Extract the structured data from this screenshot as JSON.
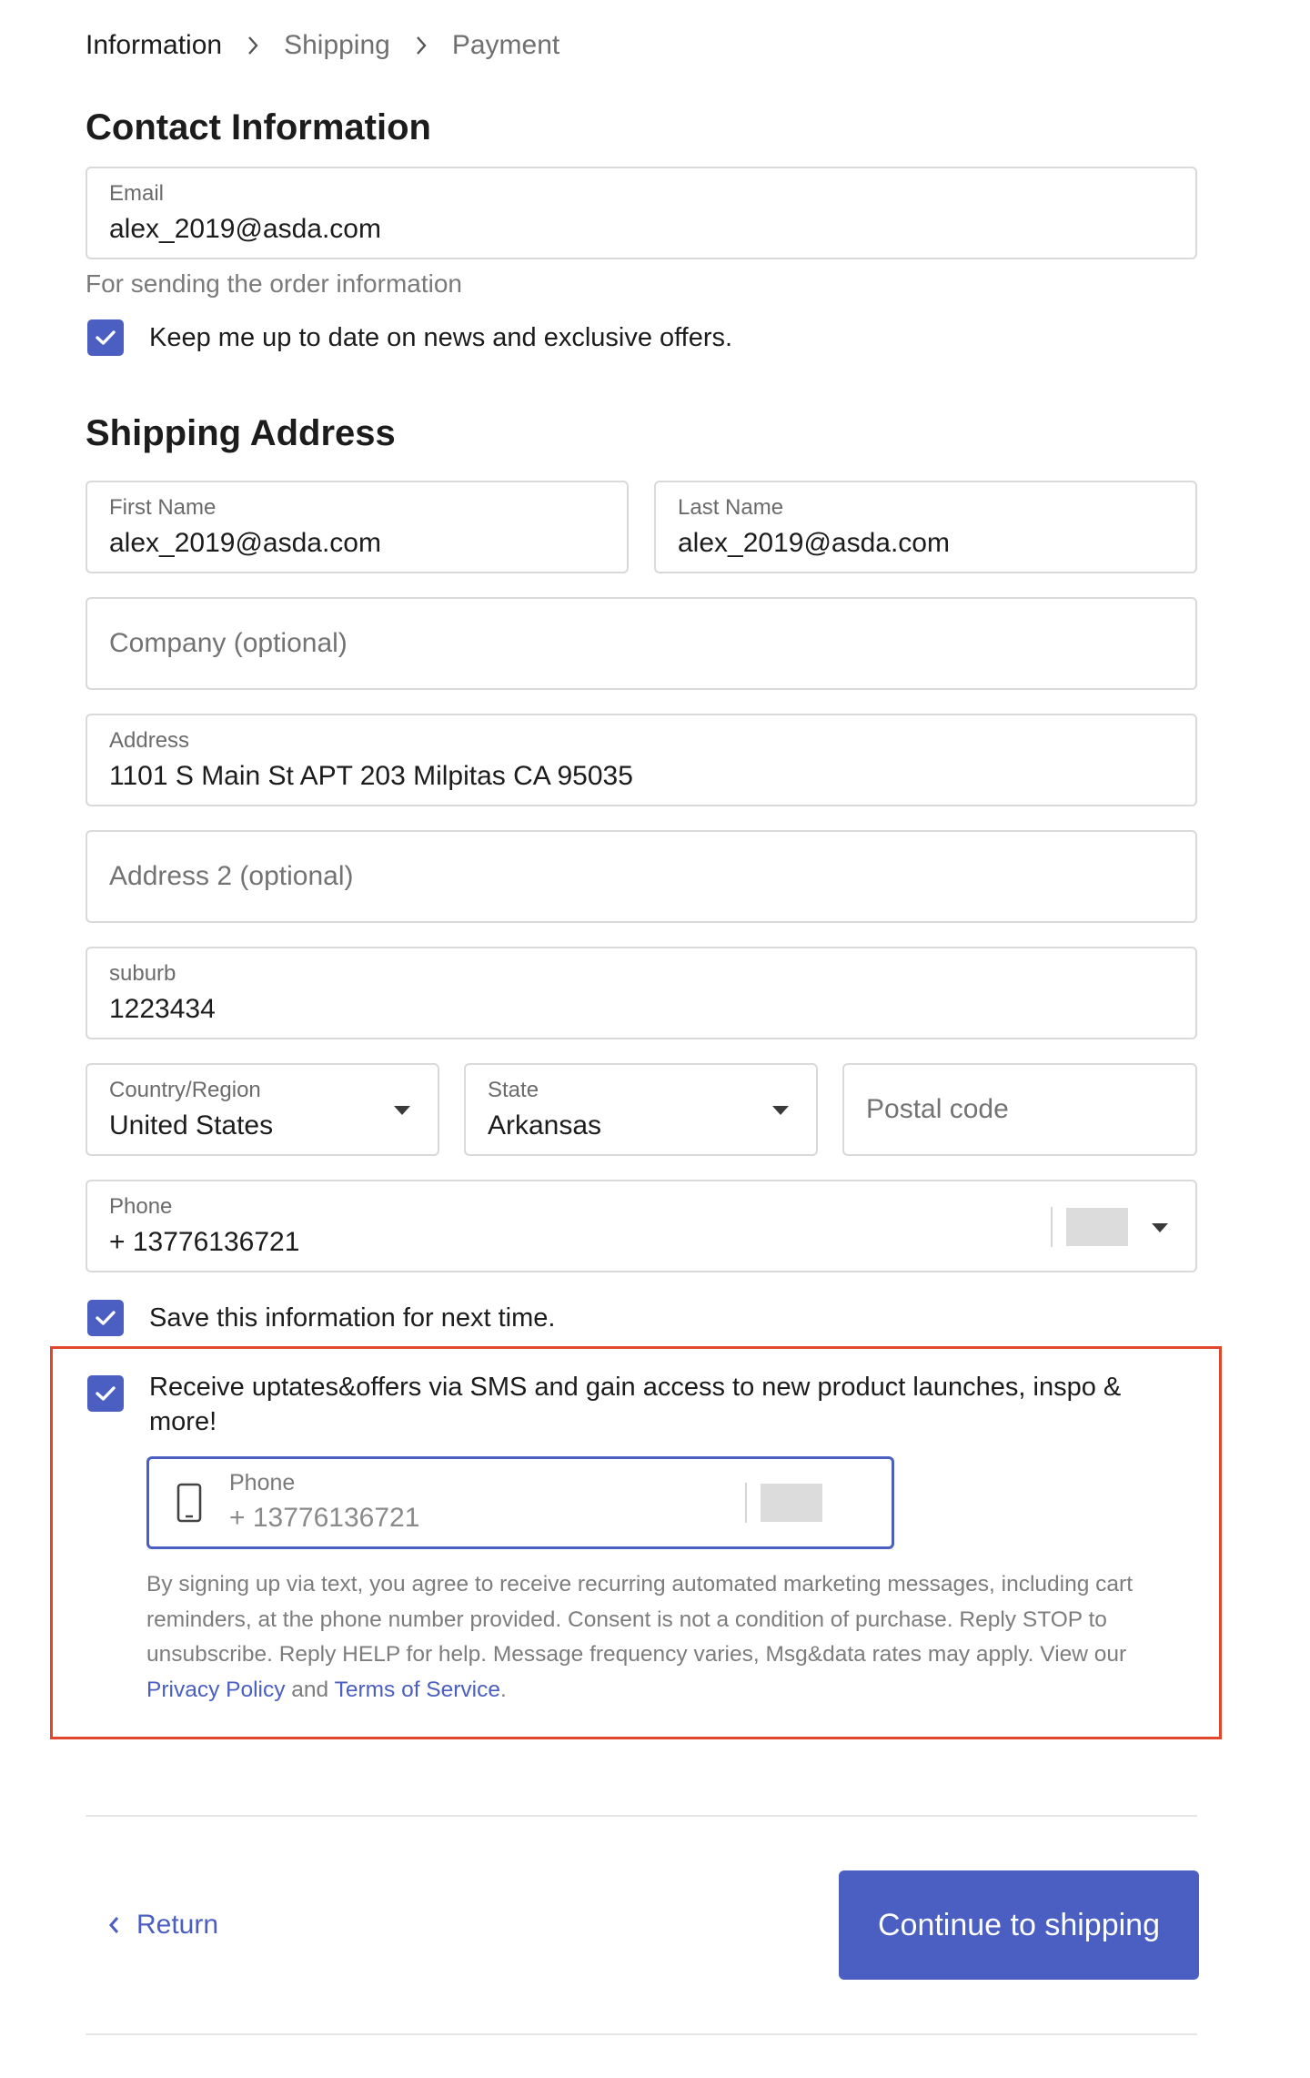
{
  "breadcrumb": {
    "items": [
      {
        "label": "Information",
        "active": true
      },
      {
        "label": "Shipping",
        "active": false
      },
      {
        "label": "Payment",
        "active": false
      }
    ]
  },
  "contact": {
    "title": "Contact Information",
    "email_label": "Email",
    "email_value": "alex_2019@asda.com",
    "helper": "For sending the order information",
    "newsletter_label": "Keep me up to date on news and exclusive offers.",
    "newsletter_checked": true
  },
  "shipping": {
    "title": "Shipping Address",
    "first_name_label": "First Name",
    "first_name_value": "alex_2019@asda.com",
    "last_name_label": "Last Name",
    "last_name_value": "alex_2019@asda.com",
    "company_placeholder": "Company (optional)",
    "address_label": "Address",
    "address_value": "1101 S Main St APT 203 Milpitas CA 95035",
    "address2_placeholder": "Address 2 (optional)",
    "suburb_label": "suburb",
    "suburb_value": "1223434",
    "country_label": "Country/Region",
    "country_value": "United States",
    "state_label": "State",
    "state_value": "Arkansas",
    "postal_placeholder": "Postal code",
    "phone_label": "Phone",
    "phone_value": "+ 13776136721",
    "save_info_label": "Save this information for next time.",
    "save_info_checked": true
  },
  "sms": {
    "optin_label": "Receive uptates&offers via SMS and gain access to new product launches, inspo & more!",
    "optin_checked": true,
    "phone_label": "Phone",
    "phone_value": "+ 13776136721",
    "legal_text": "By signing up via text, you agree to receive recurring automated marketing messages, including cart reminders, at the phone number provided. Consent is not a condition of purchase. Reply STOP to unsubscribe. Reply HELP for help. Message frequency varies, Msg&data rates may apply. View our",
    "privacy_link": "Privacy Policy",
    "and_text": "and",
    "terms_link": "Terms of Service",
    "period": ".",
    "highlight_color": "#e2462b"
  },
  "footer": {
    "return_label": "Return",
    "continue_label": "Continue to shipping"
  },
  "colors": {
    "accent": "#4a5fc1",
    "border": "#d9d9d9"
  },
  "icons": {
    "breadcrumb_separator": "chevron-right-icon",
    "checkbox": "checkmark-icon",
    "dropdown": "caret-down-icon",
    "sms_phone": "mobile-phone-icon",
    "return": "chevron-left-icon"
  }
}
